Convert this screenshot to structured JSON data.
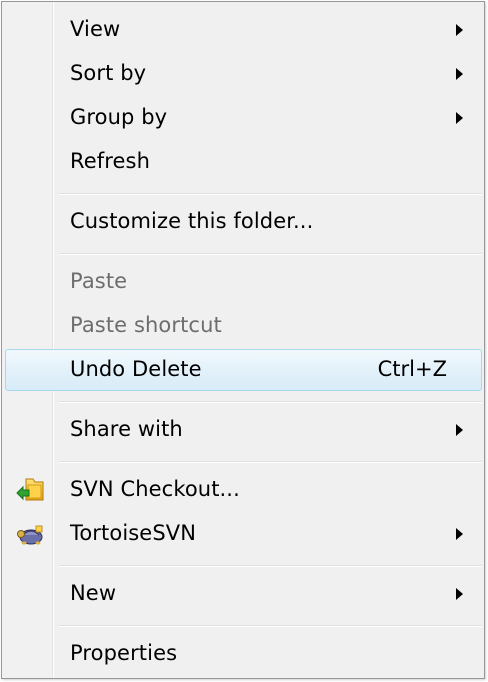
{
  "menu": {
    "items": [
      {
        "label": "View"
      },
      {
        "label": "Sort by"
      },
      {
        "label": "Group by"
      },
      {
        "label": "Refresh"
      },
      {
        "label": "Customize this folder..."
      },
      {
        "label": "Paste"
      },
      {
        "label": "Paste shortcut"
      },
      {
        "label": "Undo Delete",
        "shortcut": "Ctrl+Z"
      },
      {
        "label": "Share with"
      },
      {
        "label": "SVN Checkout...",
        "icon": "svn-checkout-icon"
      },
      {
        "label": "TortoiseSVN",
        "icon": "tortoisesvn-icon"
      },
      {
        "label": "New"
      },
      {
        "label": "Properties"
      }
    ]
  },
  "colors": {
    "highlight_border": "#a8d8eb",
    "disabled_text": "#6d6d6d",
    "menu_background": "#f0f0f0"
  }
}
